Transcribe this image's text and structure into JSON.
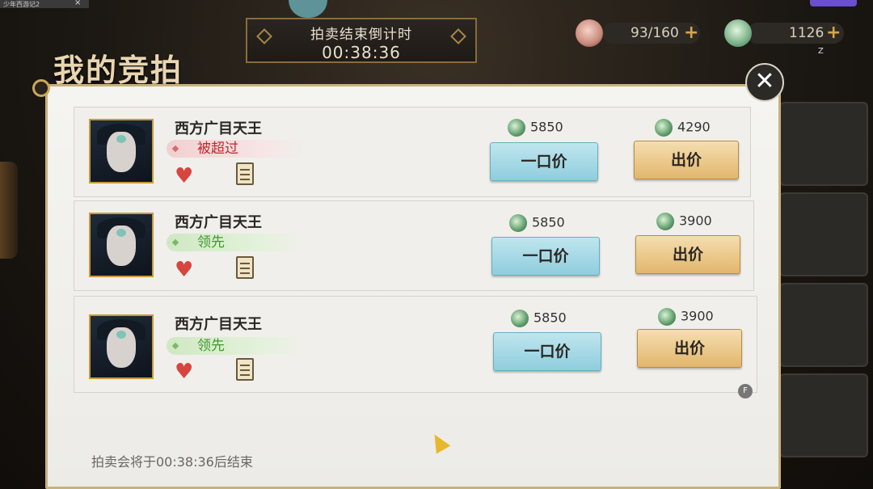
{
  "window": {
    "tab_title": "少年西游记2",
    "tab_close": "×"
  },
  "header": {
    "page_title": "我的竞拍",
    "countdown_label": "拍卖结束倒计时",
    "countdown_value": "00:38:36",
    "resource_stamina": {
      "value": "93/160",
      "plus": "+"
    },
    "resource_jade": {
      "value": "1126",
      "plus": "+"
    },
    "corner_hint": "Z"
  },
  "panel": {
    "close_label": "✕",
    "rows": [
      {
        "item_name": "西方广目天王",
        "status": "被超过",
        "status_type": "outbid",
        "buyout_price": "5850",
        "buyout_label": "一口价",
        "current_bid": "4290",
        "bid_label": "出价"
      },
      {
        "item_name": "西方广目天王",
        "status": "领先",
        "status_type": "lead",
        "buyout_price": "5850",
        "buyout_label": "一口价",
        "current_bid": "3900",
        "bid_label": "出价"
      },
      {
        "item_name": "西方广目天王",
        "status": "领先",
        "status_type": "lead",
        "buyout_price": "5850",
        "buyout_label": "一口价",
        "current_bid": "3900",
        "bid_label": "出价"
      }
    ],
    "f_badge": "F",
    "footer_note": "拍卖会将于00:38:36后结束"
  },
  "colors": {
    "outbid": "#c3282e",
    "lead": "#3f9a2e",
    "buy_button": "#8fcddd",
    "bid_button": "#e2b66d"
  },
  "icons": [
    "jade-currency-icon",
    "heart-icon",
    "note-icon",
    "close-icon",
    "stamina-icon"
  ]
}
